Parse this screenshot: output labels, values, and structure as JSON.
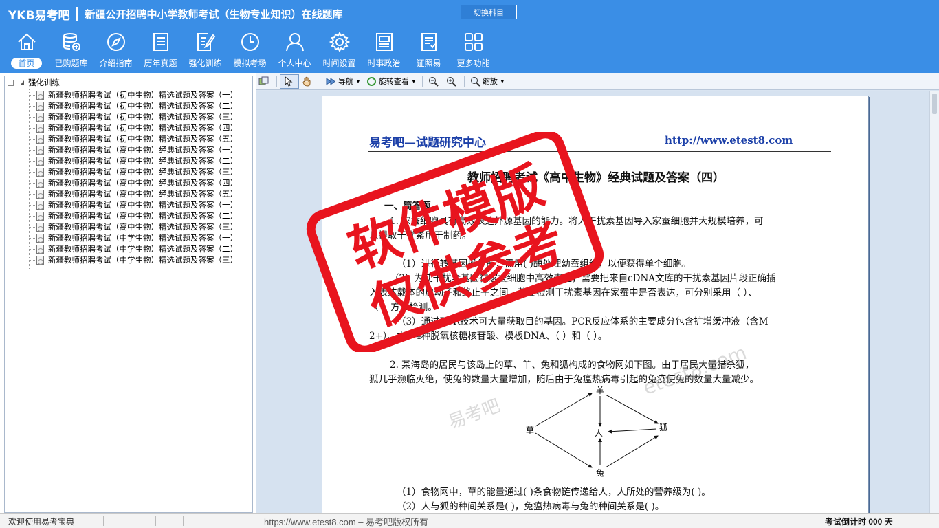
{
  "header": {
    "logo": "YKB易考吧",
    "title": "新疆公开招聘中小学教师考试（生物专业知识）在线题库",
    "switch_label": "切换科目"
  },
  "nav": [
    {
      "label": "首页",
      "icon": "home-icon",
      "active": true
    },
    {
      "label": "已购题库",
      "icon": "database-icon"
    },
    {
      "label": "介绍指南",
      "icon": "compass-icon"
    },
    {
      "label": "历年真题",
      "icon": "document-list-icon"
    },
    {
      "label": "强化训练",
      "icon": "edit-document-icon"
    },
    {
      "label": "模拟考场",
      "icon": "clock-icon"
    },
    {
      "label": "个人中心",
      "icon": "user-icon"
    },
    {
      "label": "时间设置",
      "icon": "gear-icon"
    },
    {
      "label": "时事政治",
      "icon": "newspaper-icon"
    },
    {
      "label": "证照易",
      "icon": "certificate-icon"
    },
    {
      "label": "更多功能",
      "icon": "grid-icon"
    }
  ],
  "tree": {
    "root": "强化训练",
    "items": [
      "新疆教师招聘考试（初中生物）精选试题及答案（一）",
      "新疆教师招聘考试（初中生物）精选试题及答案（二）",
      "新疆教师招聘考试（初中生物）精选试题及答案（三）",
      "新疆教师招聘考试（初中生物）精选试题及答案（四）",
      "新疆教师招聘考试（初中生物）精选试题及答案（五）",
      "新疆教师招聘考试（高中生物）经典试题及答案（一）",
      "新疆教师招聘考试（高中生物）经典试题及答案（二）",
      "新疆教师招聘考试（高中生物）经典试题及答案（三）",
      "新疆教师招聘考试（高中生物）经典试题及答案（四）",
      "新疆教师招聘考试（高中生物）经典试题及答案（五）",
      "新疆教师招聘考试（高中生物）精选试题及答案（一）",
      "新疆教师招聘考试（高中生物）精选试题及答案（二）",
      "新疆教师招聘考试（高中生物）精选试题及答案（三）",
      "新疆教师招聘考试（中学生物）精选试题及答案（一）",
      "新疆教师招聘考试（中学生物）精选试题及答案（二）",
      "新疆教师招聘考试（中学生物）精选试题及答案（三）"
    ]
  },
  "toolbar": {
    "nav_label": "导航",
    "rotate_label": "旋转查看",
    "zoom_label": "缩放"
  },
  "document": {
    "header_left": "易考吧—试题研究中心",
    "header_right": "http://www.etest8.com",
    "title": "教师招聘考试《高中生物》经典试题及答案（四）",
    "lines": [
      "一、简答题",
      "1. 家蚕细胞具有高效表达外源基因的能力。将人干扰素基因导入家蚕细胞并大规模培养，可",
      "以提取干扰素用于制药。",
      "（1）进行转基因操作前，需用(  )酶处理幼蚕组织，以便获得单个细胞。",
      "（2）为使干扰素基因在家蚕细胞中高效表达，需要把来自cDNA文库的干扰素基因片段正确插",
      "入表达载体的启动子和终止子之间。若要检测干扰素基因在家蚕中是否表达，可分别采用（  ）、",
      "（  ）方法检测。",
      "（3）通过PCR技术可大量获取目的基因。PCR反应体系的主要成分包含扩增缓冲液（含M",
      "2+）、水、4种脱氧核糖核苷酸、模板DNA、（  ）和（  ）。",
      "2. 某海岛的居民与该岛上的草、羊、兔和狐构成的食物网如下图。由于居民大量猎杀狐，",
      "狐几乎濒临灭绝，使兔的数量大量增加，随后由于兔瘟热病毒引起的兔疫使兔的数量大量减少。",
      "（1）食物网中，草的能量通过(  )条食物链传递给人，人所处的营养级为(  )。",
      "（2）人与狐的种间关系是(  )，兔瘟热病毒与兔的种间关系是(  )。"
    ],
    "web_labels": {
      "top": "羊",
      "left": "草",
      "center": "人",
      "right": "狐",
      "bottom": "兔"
    },
    "stamp_line1": "软件模版",
    "stamp_line2": "仅供参考",
    "watermark1": "易考吧",
    "watermark2": "etest8.com"
  },
  "statusbar": {
    "welcome": "欢迎使用易考宝典",
    "copyright": "https://www.etest8.com – 易考吧版权所有",
    "countdown": "考试倒计时 000 天"
  },
  "colors": {
    "header_blue": "#3a8ee6",
    "doc_blue": "#1b3fa8",
    "stamp_red": "#e8141e"
  }
}
